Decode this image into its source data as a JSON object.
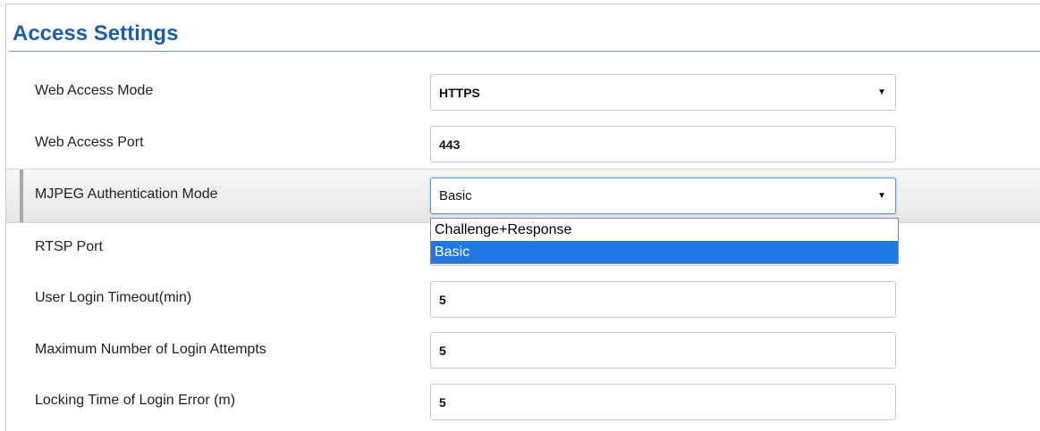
{
  "section": {
    "title": "Access Settings"
  },
  "fields": {
    "web_access_mode": {
      "label": "Web Access Mode",
      "value": "HTTPS"
    },
    "web_access_port": {
      "label": "Web Access Port",
      "value": "443"
    },
    "mjpeg_auth_mode": {
      "label": "MJPEG Authentication Mode",
      "value": "Basic",
      "options": [
        "Challenge+Response",
        "Basic"
      ],
      "selected_option": "Basic"
    },
    "rtsp_port": {
      "label": "RTSP Port"
    },
    "user_login_timeout": {
      "label": "User Login Timeout(min)",
      "value": "5"
    },
    "max_login_attempts": {
      "label": "Maximum Number of Login Attempts",
      "value": "5"
    },
    "locking_time": {
      "label": "Locking Time of Login Error (m)",
      "value": "5"
    }
  },
  "icons": {
    "select_arrow": "▼"
  },
  "colors": {
    "title": "#1f5fa8",
    "selected_option_bg": "#1e78e6",
    "focus_border": "#5b9be0"
  }
}
